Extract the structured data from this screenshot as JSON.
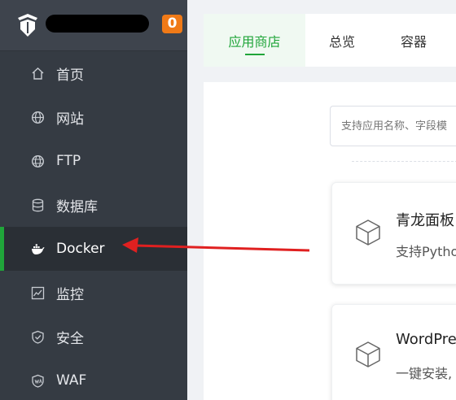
{
  "sidebar": {
    "badge_count": "0",
    "items": [
      {
        "label": "首页",
        "icon": "home-icon"
      },
      {
        "label": "网站",
        "icon": "globe-icon"
      },
      {
        "label": "FTP",
        "icon": "ftp-globe-icon"
      },
      {
        "label": "数据库",
        "icon": "database-icon"
      },
      {
        "label": "Docker",
        "icon": "docker-icon",
        "active": true
      },
      {
        "label": "监控",
        "icon": "monitor-icon"
      },
      {
        "label": "安全",
        "icon": "shield-icon"
      },
      {
        "label": "WAF",
        "icon": "waf-shield-icon"
      }
    ]
  },
  "tabs": [
    {
      "label": "应用商店",
      "active": true
    },
    {
      "label": "总览"
    },
    {
      "label": "容器"
    }
  ],
  "search": {
    "placeholder": "支持应用名称、字段模"
  },
  "apps": [
    {
      "title": "青龙面板",
      "desc": "支持Python"
    },
    {
      "title": "WordPress",
      "desc": "一键安装,"
    }
  ],
  "colors": {
    "accent": "#20a53a",
    "badge": "#f07a17",
    "sidebar": "#353b43",
    "arrow": "#e02020"
  }
}
